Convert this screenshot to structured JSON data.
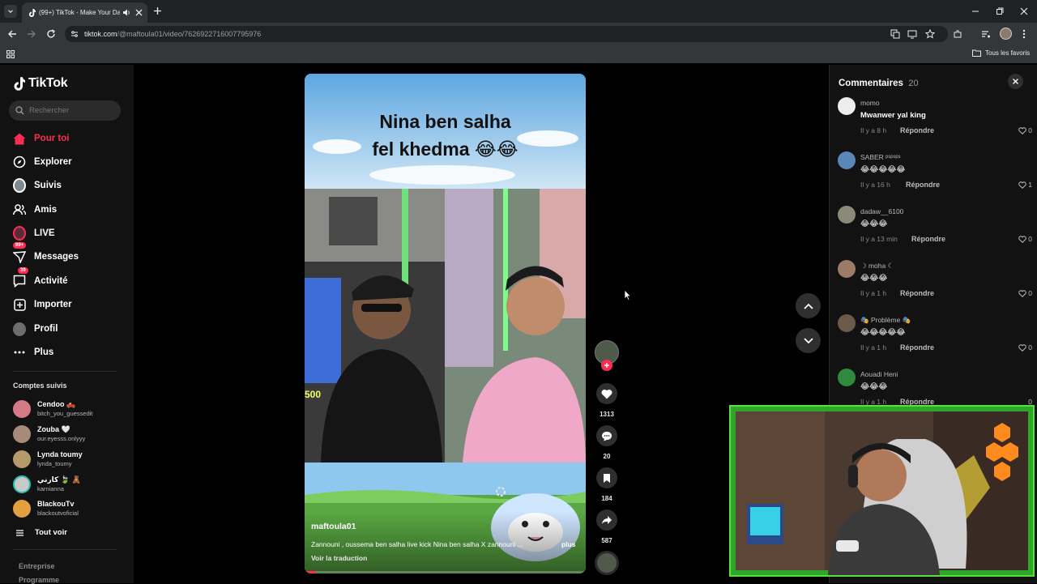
{
  "browser": {
    "tab_title": "(99+) TikTok - Make Your Da",
    "url_domain": "tiktok.com",
    "url_path": "/@maftoula01/video/7626922716007795976",
    "bookmarks_folder": "Tous les favoris"
  },
  "sidebar": {
    "logo": "TikTok",
    "search_placeholder": "Rechercher",
    "nav": [
      {
        "label": "Pour toi",
        "icon": "home-icon",
        "active": true
      },
      {
        "label": "Explorer",
        "icon": "compass-icon"
      },
      {
        "label": "Suivis",
        "icon": "following-avatar-icon"
      },
      {
        "label": "Amis",
        "icon": "friends-icon"
      },
      {
        "label": "LIVE",
        "icon": "live-icon"
      },
      {
        "label": "Messages",
        "icon": "messages-icon",
        "badge": "99+"
      },
      {
        "label": "Activité",
        "icon": "activity-icon",
        "badge": "39"
      },
      {
        "label": "Importer",
        "icon": "upload-icon"
      },
      {
        "label": "Profil",
        "icon": "profile-icon"
      },
      {
        "label": "Plus",
        "icon": "more-icon"
      }
    ],
    "followed_title": "Comptes suivis",
    "followed": [
      {
        "name": "Cendoo 🛻",
        "username": "bitch_you_guessedit"
      },
      {
        "name": "Zouba 🤍",
        "username": "our.eyesss.onlyyy"
      },
      {
        "name": "Lynda toumy",
        "username": "lynda_toumy"
      },
      {
        "name": "كارني 🍃 🧸",
        "username": "karnianna"
      },
      {
        "name": "BlackouTv",
        "username": "blackoutvoficial"
      }
    ],
    "see_all": "Tout voir",
    "footer": [
      "Entreprise",
      "Programme"
    ]
  },
  "video": {
    "caption_line1": "Nina ben salha",
    "caption_line2": "fel khedma 😂😂",
    "overlay_number": "500",
    "author": "maftoula01",
    "description": "Zannouni , oussema ben salha live kick Nina ben salha X zannouni ...",
    "more": "plus",
    "translate": "Voir la traduction"
  },
  "actions": {
    "likes": "1313",
    "comments": "20",
    "saves": "184",
    "shares": "587"
  },
  "comments_panel": {
    "title": "Commentaires",
    "count": "20",
    "reply_label": "Répondre",
    "items": [
      {
        "user": "momo",
        "text": "Mwanwer yal king",
        "time": "Il y a 8 h",
        "likes": "0"
      },
      {
        "user": "SABER ᵖˢᵖˢᵖˢ",
        "text": "😂😂😂😂😂",
        "time": "Il y a 16 h",
        "likes": "1"
      },
      {
        "user": "dadaw__6100",
        "text": "😂😂😂",
        "time": "Il y a 13 min",
        "likes": "0"
      },
      {
        "user": "☽ moha ☾",
        "text": "😂😂😂",
        "time": "Il y a 1 h",
        "likes": "0"
      },
      {
        "user": "🎭 Problème 🎭",
        "text": "😂😂😂😂😂",
        "time": "Il y a 1 h",
        "likes": "0"
      },
      {
        "user": "Aouadi Heni",
        "text": "😂😂😂",
        "time": "Il y a 1 h",
        "likes": "0"
      }
    ]
  },
  "colors": {
    "accent": "#fe2c55",
    "page_bg": "#121212",
    "webcam_border": "#57e03f"
  }
}
